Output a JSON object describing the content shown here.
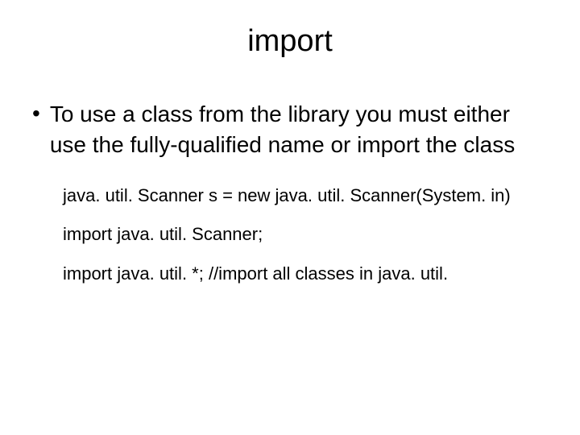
{
  "title": "import",
  "bullet": {
    "text": "To use a class from the library you must either use the fully-qualified name or import the class"
  },
  "code": {
    "line1": "java. util. Scanner s = new java. util. Scanner(System. in)",
    "line2": "import java. util. Scanner;",
    "line3": "import java. util. *; //import all classes in java. util."
  }
}
